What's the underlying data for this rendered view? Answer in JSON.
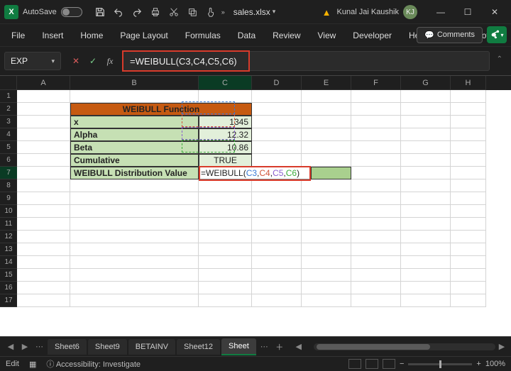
{
  "titlebar": {
    "autosave_label": "AutoSave",
    "filename": "sales.xlsx",
    "user_name": "Kunal Jai Kaushik",
    "user_initials": "KJ"
  },
  "ribbon": {
    "tabs": [
      "File",
      "Insert",
      "Home",
      "Page Layout",
      "Formulas",
      "Data",
      "Review",
      "View",
      "Developer",
      "Help",
      "Power Pivot"
    ],
    "comments_label": "Comments"
  },
  "formula_bar": {
    "namebox": "EXP",
    "formula": "=WEIBULL(C3,C4,C5,C6)"
  },
  "columns": [
    "A",
    "B",
    "C",
    "D",
    "E",
    "F",
    "G",
    "H"
  ],
  "row_numbers": [
    "1",
    "2",
    "3",
    "4",
    "5",
    "6",
    "7",
    "8",
    "9",
    "10",
    "11",
    "12",
    "13",
    "14",
    "15",
    "16",
    "17"
  ],
  "cells": {
    "header": "WEIBULL Function",
    "x_label": "x",
    "x_val": "1345",
    "alpha_label": "Alpha",
    "alpha_val": "12.32",
    "beta_label": "Beta",
    "beta_val": "10.86",
    "cum_label": "Cumulative",
    "cum_val": "TRUE",
    "dist_label": "WEIBULL Distribution Value",
    "edit_prefix": "=WEIBULL(",
    "edit_c3": "C3",
    "edit_c4": "C4",
    "edit_c5": "C5",
    "edit_c6": "C6",
    "edit_suffix": ")"
  },
  "sheet_tabs": [
    "Sheet6",
    "Sheet9",
    "BETAINV",
    "Sheet12",
    "Sheet"
  ],
  "statusbar": {
    "mode": "Edit",
    "accessibility": "Accessibility: Investigate",
    "zoom": "100%"
  },
  "chart_data": {
    "type": "table",
    "title": "WEIBULL Function",
    "rows": [
      {
        "label": "x",
        "value": 1345
      },
      {
        "label": "Alpha",
        "value": 12.32
      },
      {
        "label": "Beta",
        "value": 10.86
      },
      {
        "label": "Cumulative",
        "value": "TRUE"
      },
      {
        "label": "WEIBULL Distribution Value",
        "value": "=WEIBULL(C3,C4,C5,C6)"
      }
    ]
  }
}
